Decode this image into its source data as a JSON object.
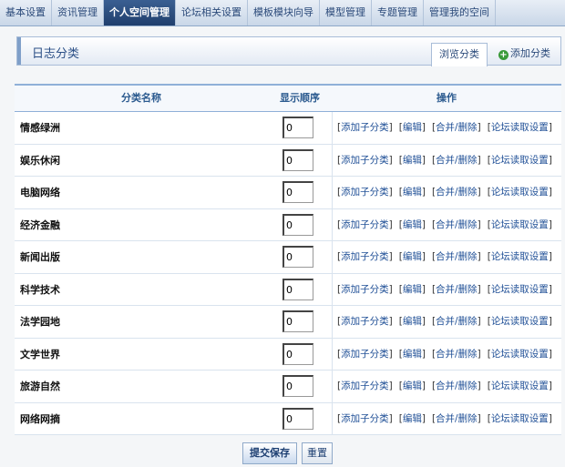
{
  "topnav": {
    "tabs": [
      {
        "label": "基本设置"
      },
      {
        "label": "资讯管理"
      },
      {
        "label": "个人空间管理",
        "active": true
      },
      {
        "label": "论坛相关设置"
      },
      {
        "label": "模板模块向导"
      },
      {
        "label": "模型管理"
      },
      {
        "label": "专题管理"
      },
      {
        "label": "管理我的空间"
      }
    ]
  },
  "section": {
    "title": "日志分类",
    "browse_tab": "浏览分类",
    "add_tab": "添加分类"
  },
  "table": {
    "headers": {
      "name": "分类名称",
      "order": "显示顺序",
      "ops": "操作"
    },
    "ops_labels": [
      "添加子分类",
      "编辑",
      "合并/删除",
      "论坛读取设置"
    ],
    "rows": [
      {
        "name": "情感绿洲",
        "order": "0"
      },
      {
        "name": "娱乐休闲",
        "order": "0"
      },
      {
        "name": "电脑网络",
        "order": "0"
      },
      {
        "name": "经济金融",
        "order": "0"
      },
      {
        "name": "新闻出版",
        "order": "0"
      },
      {
        "name": "科学技术",
        "order": "0"
      },
      {
        "name": "法学园地",
        "order": "0"
      },
      {
        "name": "文学世界",
        "order": "0"
      },
      {
        "name": "旅游自然",
        "order": "0"
      },
      {
        "name": "网络网摘",
        "order": "0"
      }
    ]
  },
  "buttons": {
    "submit": "提交保存",
    "reset": "重置"
  }
}
